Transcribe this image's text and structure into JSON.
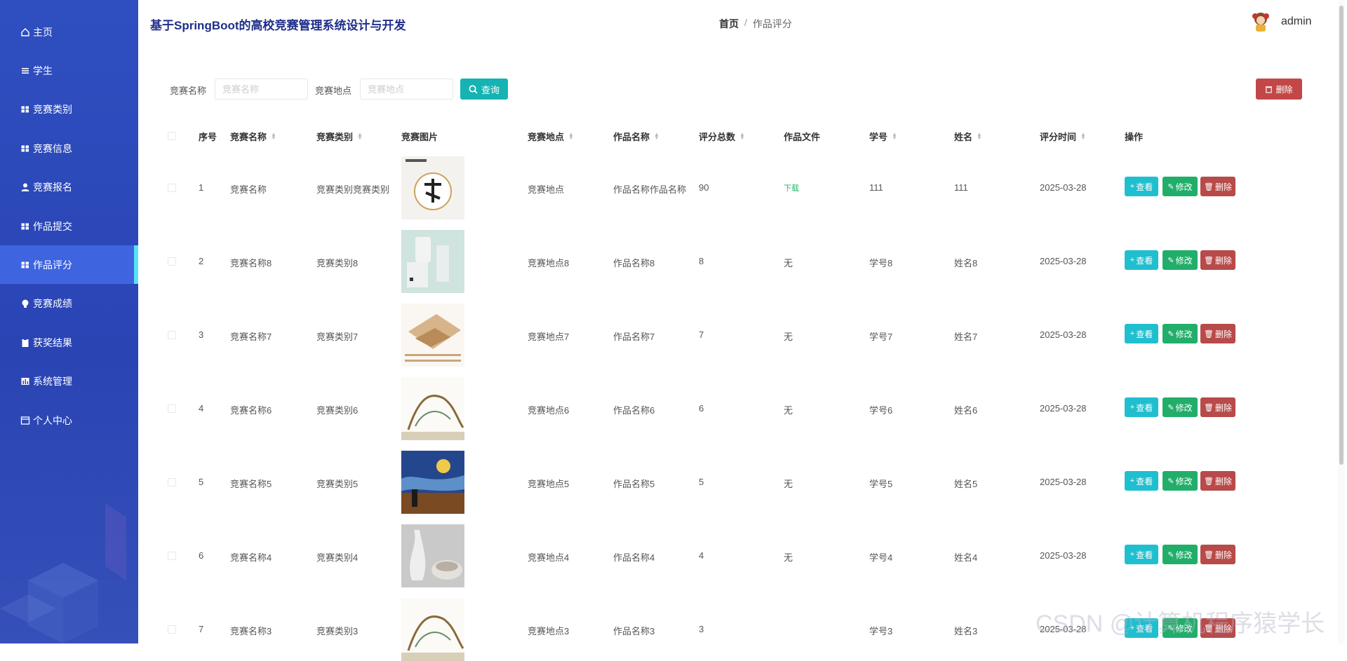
{
  "app": {
    "title": "基于SpringBoot的高校竞赛管理系统设计与开发",
    "username": "admin"
  },
  "breadcrumb": {
    "home": "首页",
    "separator": "/",
    "current": "作品评分"
  },
  "sidebar": {
    "items": [
      {
        "label": "主页",
        "icon": "home-icon"
      },
      {
        "label": "学生",
        "icon": "list-icon"
      },
      {
        "label": "竞赛类别",
        "icon": "grid-icon"
      },
      {
        "label": "竞赛信息",
        "icon": "grid-icon"
      },
      {
        "label": "竞赛报名",
        "icon": "user-icon"
      },
      {
        "label": "作品提交",
        "icon": "grid-icon"
      },
      {
        "label": "作品评分",
        "icon": "grid-icon",
        "active": true
      },
      {
        "label": "竞赛成绩",
        "icon": "bulb-icon"
      },
      {
        "label": "获奖结果",
        "icon": "clipboard-icon"
      },
      {
        "label": "系统管理",
        "icon": "chart-icon"
      },
      {
        "label": "个人中心",
        "icon": "window-icon"
      }
    ]
  },
  "search": {
    "name_label": "竞赛名称",
    "name_placeholder": "竞赛名称",
    "location_label": "竞赛地点",
    "location_placeholder": "竞赛地点",
    "search_button": "查询",
    "delete_button": "删除"
  },
  "table": {
    "columns": [
      "序号",
      "竞赛名称",
      "竞赛类别",
      "竞赛图片",
      "竞赛地点",
      "作品名称",
      "评分总数",
      "作品文件",
      "学号",
      "姓名",
      "评分时间",
      "操作"
    ],
    "sortable": [
      false,
      true,
      true,
      false,
      true,
      true,
      true,
      false,
      true,
      true,
      true,
      false
    ],
    "rows": [
      {
        "no": "1",
        "name": "竞赛名称",
        "category": "竞赛类别竞赛类别",
        "location": "竞赛地点",
        "work": "作品名称作品名称",
        "score": "90",
        "file": "下载",
        "student_no": "111",
        "student_name": "111",
        "time": "2025-03-28",
        "image": "calligraphy"
      },
      {
        "no": "2",
        "name": "竞赛名称8",
        "category": "竞赛类别8",
        "location": "竞赛地点8",
        "work": "作品名称8",
        "score": "8",
        "file": "无",
        "student_no": "学号8",
        "student_name": "姓名8",
        "time": "2025-03-28",
        "image": "product"
      },
      {
        "no": "3",
        "name": "竞赛名称7",
        "category": "竞赛类别7",
        "location": "竞赛地点7",
        "work": "作品名称7",
        "score": "7",
        "file": "无",
        "student_no": "学号7",
        "student_name": "姓名7",
        "time": "2025-03-28",
        "image": "sketch"
      },
      {
        "no": "4",
        "name": "竞赛名称6",
        "category": "竞赛类别6",
        "location": "竞赛地点6",
        "work": "作品名称6",
        "score": "6",
        "file": "无",
        "student_no": "学号6",
        "student_name": "姓名6",
        "time": "2025-03-28",
        "image": "tree"
      },
      {
        "no": "5",
        "name": "竞赛名称5",
        "category": "竞赛类别5",
        "location": "竞赛地点5",
        "work": "作品名称5",
        "score": "5",
        "file": "无",
        "student_no": "学号5",
        "student_name": "姓名5",
        "time": "2025-03-28",
        "image": "painting"
      },
      {
        "no": "6",
        "name": "竞赛名称4",
        "category": "竞赛类别4",
        "location": "竞赛地点4",
        "work": "作品名称4",
        "score": "4",
        "file": "无",
        "student_no": "学号4",
        "student_name": "姓名4",
        "time": "2025-03-28",
        "image": "ceramics"
      },
      {
        "no": "7",
        "name": "竞赛名称3",
        "category": "竞赛类别3",
        "location": "竞赛地点3",
        "work": "作品名称3",
        "score": "3",
        "file": "",
        "student_no": "学号3",
        "student_name": "姓名3",
        "time": "2025-03-28",
        "image": "tree"
      }
    ],
    "actions": {
      "view": "查看",
      "edit": "修改",
      "delete": "删除"
    }
  },
  "colors": {
    "sidebar": "#2a44b4",
    "active_item": "#3f64e0",
    "accent": "#56e2f5",
    "search_button": "#17b3b3",
    "view": "#20bfcf",
    "edit": "#21ae6a",
    "delete": "#b84a4a"
  },
  "watermark": "CSDN @计算机程序猿学长"
}
